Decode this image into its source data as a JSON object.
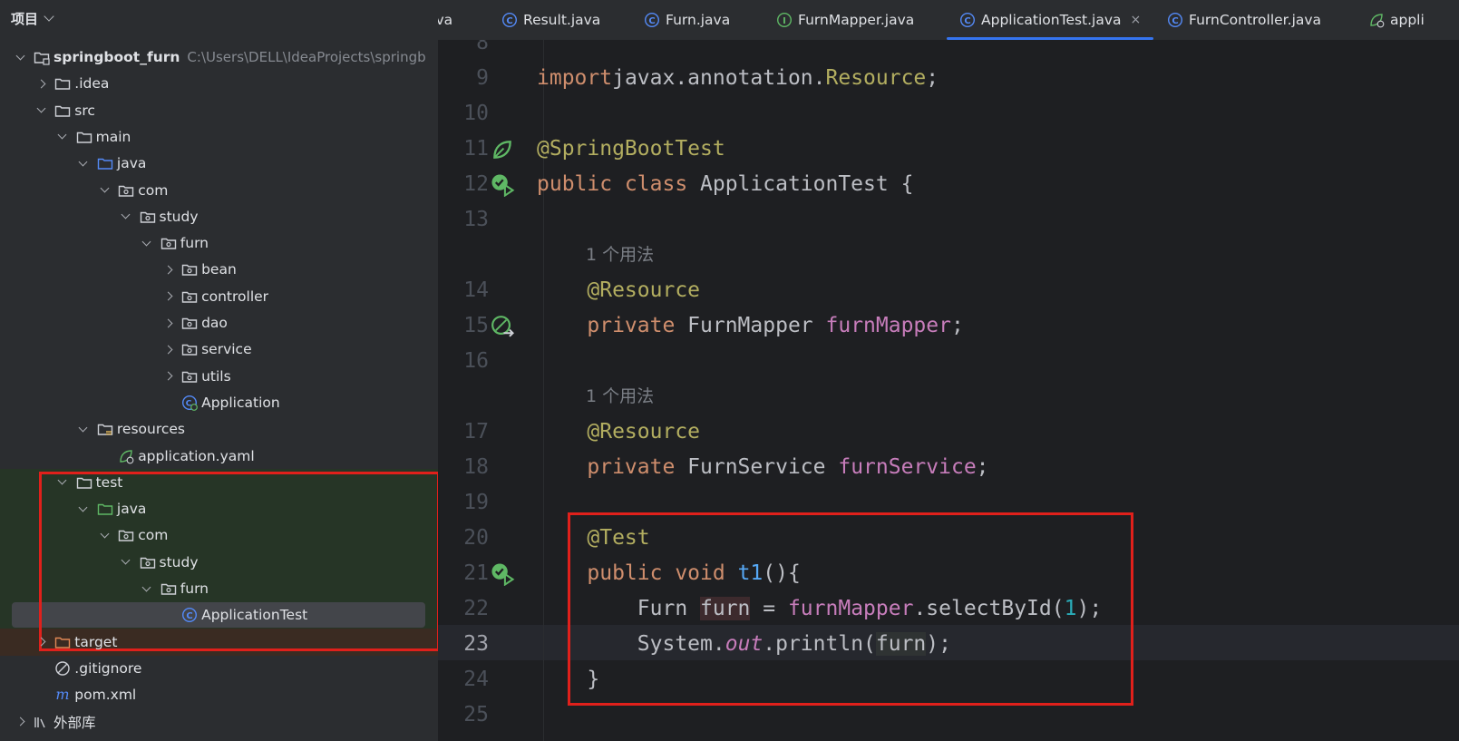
{
  "project_panel": {
    "title": "项目",
    "root": {
      "name": "springboot_furn",
      "path": "C:\\Users\\DELL\\IdeaProjects\\springb"
    },
    "items": [
      {
        "label": "springboot_furn",
        "chevron": "down",
        "icon": "module-folder-icon",
        "depth": 0
      },
      {
        "label": ".idea",
        "chevron": "right",
        "icon": "folder-icon",
        "depth": 1
      },
      {
        "label": "src",
        "chevron": "down",
        "icon": "folder-icon",
        "depth": 1
      },
      {
        "label": "main",
        "chevron": "down",
        "icon": "folder-icon",
        "depth": 2
      },
      {
        "label": "java",
        "chevron": "down",
        "icon": "source-folder-icon",
        "depth": 3
      },
      {
        "label": "com",
        "chevron": "down",
        "icon": "package-icon",
        "depth": 4
      },
      {
        "label": "study",
        "chevron": "down",
        "icon": "package-icon",
        "depth": 5
      },
      {
        "label": "furn",
        "chevron": "down",
        "icon": "package-icon",
        "depth": 6
      },
      {
        "label": "bean",
        "chevron": "right",
        "icon": "package-icon",
        "depth": 7
      },
      {
        "label": "controller",
        "chevron": "right",
        "icon": "package-icon",
        "depth": 7
      },
      {
        "label": "dao",
        "chevron": "right",
        "icon": "package-icon",
        "depth": 7
      },
      {
        "label": "service",
        "chevron": "right",
        "icon": "package-icon",
        "depth": 7
      },
      {
        "label": "utils",
        "chevron": "right",
        "icon": "package-icon",
        "depth": 7
      },
      {
        "label": "Application",
        "chevron": "none",
        "icon": "spring-boot-class-icon",
        "depth": 7
      },
      {
        "label": "resources",
        "chevron": "down",
        "icon": "resources-folder-icon",
        "depth": 3
      },
      {
        "label": "application.yaml",
        "chevron": "none",
        "icon": "spring-config-icon",
        "depth": 4
      },
      {
        "label": "test",
        "chevron": "down",
        "icon": "folder-icon",
        "depth": 2
      },
      {
        "label": "java",
        "chevron": "down",
        "icon": "test-source-folder-icon",
        "depth": 3
      },
      {
        "label": "com",
        "chevron": "down",
        "icon": "package-icon",
        "depth": 4
      },
      {
        "label": "study",
        "chevron": "down",
        "icon": "package-icon",
        "depth": 5
      },
      {
        "label": "furn",
        "chevron": "down",
        "icon": "package-icon",
        "depth": 6
      },
      {
        "label": "ApplicationTest",
        "chevron": "none",
        "icon": "class-icon",
        "depth": 7,
        "selected": true
      },
      {
        "label": "target",
        "chevron": "right",
        "icon": "excluded-folder-icon",
        "depth": 1
      },
      {
        "label": ".gitignore",
        "chevron": "none",
        "icon": "ignore-file-icon",
        "depth": 1
      },
      {
        "label": "pom.xml",
        "chevron": "none",
        "icon": "maven-icon",
        "depth": 1
      },
      {
        "label": "外部库",
        "chevron": "right",
        "icon": "library-icon",
        "depth": 0
      }
    ]
  },
  "tabs": [
    {
      "label": "ava",
      "icon": "none"
    },
    {
      "label": "Result.java",
      "icon": "class-icon"
    },
    {
      "label": "Furn.java",
      "icon": "class-icon"
    },
    {
      "label": "FurnMapper.java",
      "icon": "interface-icon"
    },
    {
      "label": "ApplicationTest.java",
      "icon": "class-icon",
      "active": true,
      "close": "×"
    },
    {
      "label": "FurnController.java",
      "icon": "class-icon"
    },
    {
      "label": "appli",
      "icon": "spring-config-icon"
    }
  ],
  "editor": {
    "current_line": "23",
    "lines": [
      {
        "num": "8",
        "code": []
      },
      {
        "num": "9",
        "code": [
          [
            "kw",
            "import"
          ],
          [
            "",
            "javax.annotation."
          ],
          [
            "ann",
            "Resource"
          ],
          [
            "",
            ";"
          ]
        ]
      },
      {
        "num": "10",
        "code": []
      },
      {
        "num": "11",
        "code": [
          [
            "ann",
            "@SpringBootTest"
          ]
        ],
        "gutter": "spring-bean-icon"
      },
      {
        "num": "12",
        "code": [
          [
            "kw",
            "public class "
          ],
          [
            "",
            "ApplicationTest {"
          ]
        ],
        "gutter": "run-test-icon"
      },
      {
        "num": "13",
        "code": []
      },
      {
        "num": "",
        "hint": "1 个用法"
      },
      {
        "num": "14",
        "code": [
          [
            "",
            "    "
          ],
          [
            "ann",
            "@Resource"
          ]
        ]
      },
      {
        "num": "15",
        "code": [
          [
            "",
            "    "
          ],
          [
            "kw",
            "private "
          ],
          [
            "",
            "FurnMapper "
          ],
          [
            "fld",
            "furnMapper"
          ],
          [
            "",
            ";"
          ]
        ],
        "gutter": "autowired-icon"
      },
      {
        "num": "16",
        "code": []
      },
      {
        "num": "",
        "hint": "1 个用法"
      },
      {
        "num": "17",
        "code": [
          [
            "",
            "    "
          ],
          [
            "ann",
            "@Resource"
          ]
        ]
      },
      {
        "num": "18",
        "code": [
          [
            "",
            "    "
          ],
          [
            "kw",
            "private "
          ],
          [
            "",
            "FurnService "
          ],
          [
            "fld",
            "furnService"
          ],
          [
            "",
            ";"
          ]
        ]
      },
      {
        "num": "19",
        "code": []
      },
      {
        "num": "20",
        "code": [
          [
            "",
            "    "
          ],
          [
            "ann",
            "@Test"
          ]
        ]
      },
      {
        "num": "21",
        "code": [
          [
            "",
            "    "
          ],
          [
            "kw",
            "public void "
          ],
          [
            "fn",
            "t1"
          ],
          [
            "",
            "(){"
          ]
        ],
        "gutter": "run-test-icon"
      },
      {
        "num": "22",
        "code": [
          [
            "",
            "        Furn "
          ],
          [
            "hl-write",
            "furn"
          ],
          [
            "",
            " = "
          ],
          [
            "fld",
            "furnMapper"
          ],
          [
            "",
            ".selectById("
          ],
          [
            "num",
            "1"
          ],
          [
            "",
            ");"
          ]
        ]
      },
      {
        "num": "23",
        "code": [
          [
            "",
            "        System."
          ],
          [
            "stat",
            "out"
          ],
          [
            "",
            ".println("
          ],
          [
            "hl-read",
            "furn"
          ],
          [
            "",
            ");"
          ]
        ]
      },
      {
        "num": "24",
        "code": [
          [
            "",
            "    }"
          ]
        ]
      },
      {
        "num": "25",
        "code": []
      }
    ]
  },
  "colors": {
    "highlight_box": "#e0201b",
    "accent": "#3574f0"
  }
}
